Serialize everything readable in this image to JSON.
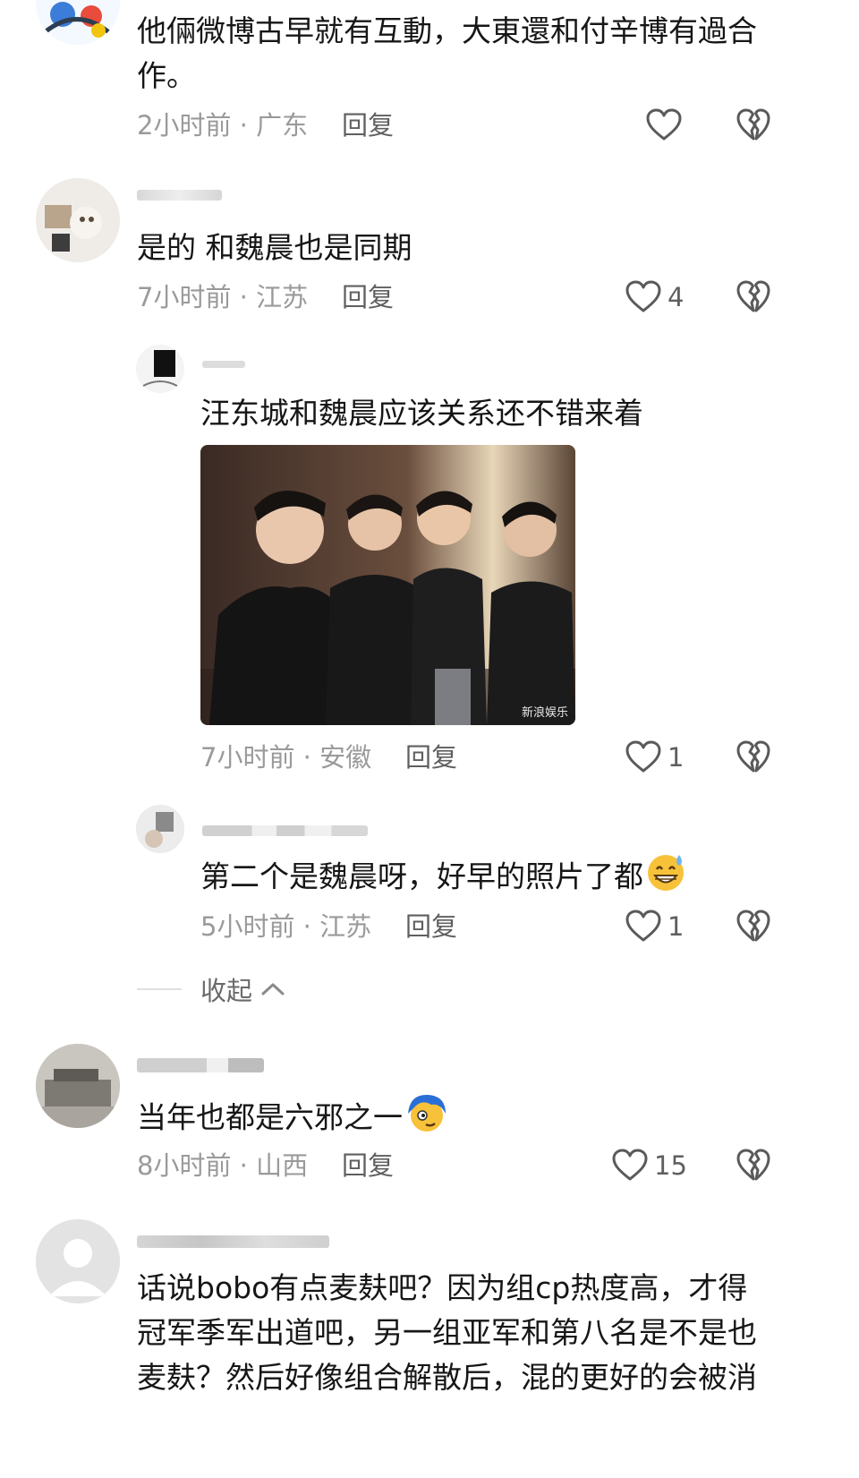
{
  "comments": [
    {
      "text_lines": [
        "他倆微博古早就有互動，大東還和付辛博有過合",
        "作。"
      ],
      "time_location": "2小时前 · 广东",
      "reply_label": "回复",
      "likes": ""
    },
    {
      "text_lines": [
        "是的  和魏晨也是同期"
      ],
      "time_location": "7小时前 · 江苏",
      "reply_label": "回复",
      "likes": "4"
    },
    {
      "text_lines": [
        "汪东城和魏晨应该关系还不错来着"
      ],
      "time_location": "7小时前 · 安徽",
      "reply_label": "回复",
      "likes": "1",
      "photo_watermark": "新浪娱乐"
    },
    {
      "text_lines": [
        "第二个是魏晨呀，好早的照片了都"
      ],
      "time_location": "5小时前 · 江苏",
      "reply_label": "回复",
      "likes": "1"
    },
    {
      "text_lines": [
        "当年也都是六邪之一"
      ],
      "time_location": "8小时前 · 山西",
      "reply_label": "回复",
      "likes": "15"
    },
    {
      "text_lines": [
        "话说bobo有点麦麸吧？因为组cp热度高，才得",
        "冠军季军出道吧，另一组亚军和第八名是不是也",
        "麦麸？然后好像组合解散后，混的更好的会被消"
      ]
    }
  ],
  "collapse": {
    "label": "收起"
  },
  "icons": {
    "like": "heart-outline-icon",
    "dislike": "broken-heart-icon",
    "collapse": "chevron-up-icon",
    "emoji_sweat": "grinning-sweat-emoji",
    "emoji_blue": "blue-hair-face-emoji"
  },
  "colors": {
    "text": "#161616",
    "meta": "#9a9a9a",
    "action": "#5f5f5f",
    "background": "#ffffff"
  }
}
